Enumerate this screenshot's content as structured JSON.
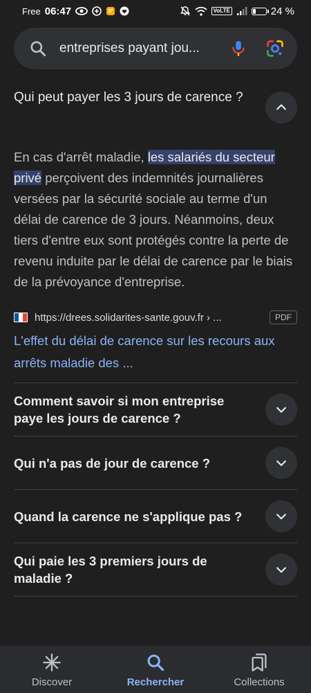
{
  "status_bar": {
    "carrier": "Free",
    "time": "06:47",
    "battery_percent_text": "24 %",
    "battery_level": 0.24,
    "network_badge": "VoLTE",
    "left_icons": [
      "eye-icon",
      "shield-icon",
      "notes-icon",
      "heart-icon"
    ],
    "right_icons": [
      "mute-icon",
      "wifi-icon",
      "signal-icon",
      "battery-icon"
    ]
  },
  "search": {
    "query": "entreprises payant jou..."
  },
  "expanded_faq": {
    "question": "Qui peut payer les 3 jours de carence ?",
    "answer_before": "En cas d'arrêt maladie, ",
    "answer_highlight": "les salariés du secteur privé",
    "answer_after": " perçoivent des indemnités journalières versées par la sécurité sociale au terme d'un délai de carence de 3 jours. Néanmoins, deux tiers d'entre eux sont protégés contre la perte de revenu induite par le délai de carence par le biais de la prévoyance d'entreprise.",
    "source_url": "https://drees.solidarites-sante.gouv.fr › ...",
    "source_badge": "PDF",
    "result_title": "L'effet du délai de carence sur les recours aux arrêts maladie des ..."
  },
  "faq_items": [
    {
      "question": "Comment savoir si mon entreprise paye les jours de carence ?"
    },
    {
      "question": "Qui n'a pas de jour de carence ?"
    },
    {
      "question": "Quand la carence ne s'applique pas ?"
    },
    {
      "question": "Qui paie les 3 premiers jours de maladie ?"
    }
  ],
  "bottom_nav": {
    "items": [
      {
        "label": "Discover",
        "icon": "asterisk-icon"
      },
      {
        "label": "Rechercher",
        "icon": "search-icon",
        "active": true
      },
      {
        "label": "Collections",
        "icon": "collections-icon"
      }
    ]
  },
  "colors": {
    "background": "#1f1f1f",
    "link": "#8ab4f8",
    "highlight": "#36426a",
    "nav_active": "#8ab4f8"
  }
}
